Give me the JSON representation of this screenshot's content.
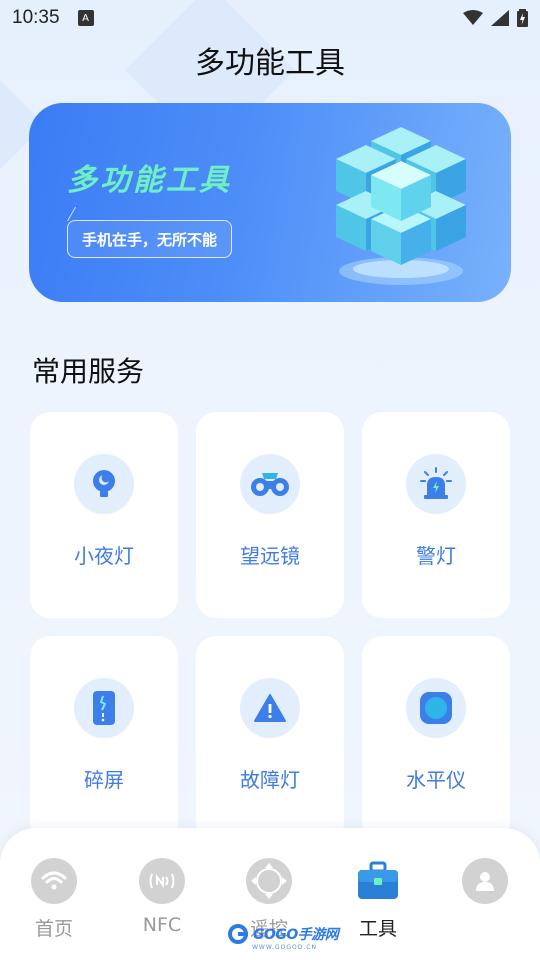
{
  "status_bar": {
    "time": "10:35",
    "notification_glyph": "A",
    "icons": [
      "wifi-icon",
      "signal-icon",
      "battery-charging-icon"
    ]
  },
  "header": {
    "title": "多功能工具"
  },
  "banner": {
    "title": "多功能工具",
    "slogan": "手机在手，无所不能",
    "art": "cubes-illustration"
  },
  "section": {
    "title": "常用服务"
  },
  "services": [
    {
      "label": "小夜灯",
      "icon": "night-light-bulb-icon"
    },
    {
      "label": "望远镜",
      "icon": "binoculars-icon"
    },
    {
      "label": "警灯",
      "icon": "siren-icon"
    },
    {
      "label": "碎屏",
      "icon": "broken-phone-icon"
    },
    {
      "label": "故障灯",
      "icon": "warning-triangle-icon"
    },
    {
      "label": "水平仪",
      "icon": "level-icon"
    }
  ],
  "bottom_nav": {
    "items": [
      {
        "label": "首页",
        "icon": "wifi-home-icon",
        "active": false
      },
      {
        "label": "NFC",
        "icon": "nfc-icon",
        "active": false
      },
      {
        "label": "遥控",
        "icon": "remote-dpad-icon",
        "active": false
      },
      {
        "label": "工具",
        "icon": "toolbox-icon",
        "active": true
      },
      {
        "label": "",
        "icon": "user-profile-icon",
        "active": false
      }
    ]
  },
  "watermark": {
    "brand": "GOGO手游网",
    "url": "WWW.GOGOD.CN"
  },
  "colors": {
    "accent": "#3f7be0",
    "banner_start": "#3b7cf5",
    "banner_end": "#78b2fb",
    "banner_title": "#6ff0c3",
    "inactive_nav": "#d2d2d2"
  }
}
